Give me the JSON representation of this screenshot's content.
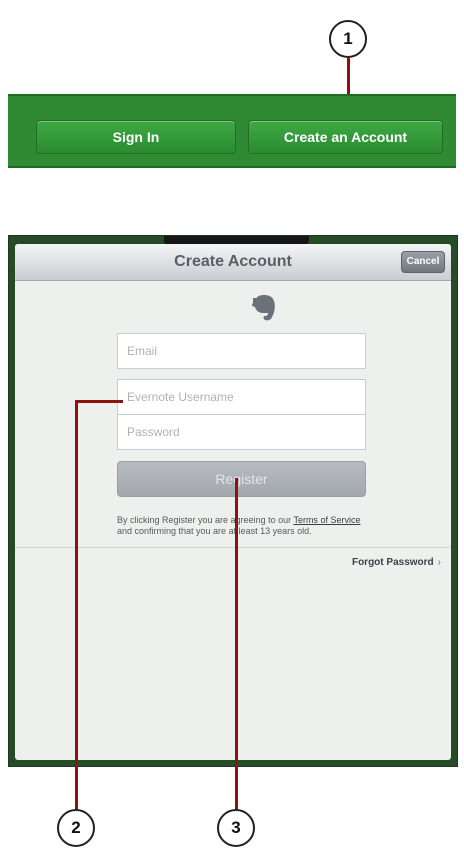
{
  "callouts": {
    "one": "1",
    "two": "2",
    "three": "3"
  },
  "top_bar": {
    "sign_in": "Sign In",
    "create_account": "Create an Account"
  },
  "dialog": {
    "title": "Create Account",
    "cancel": "Cancel",
    "logo_icon": "evernote-elephant-icon",
    "email_placeholder": "Email",
    "username_placeholder": "Evernote Username",
    "password_placeholder": "Password",
    "register": "Register",
    "terms_line1_pre": "By clicking Register you are agreeing to our ",
    "terms_link": "Terms of Service",
    "terms_line2": "and confirming that you are at least 13 years old.",
    "forgot": "Forgot Password",
    "chevron": "›"
  },
  "colors": {
    "green": "#2f8a33",
    "leader": "#8b1313"
  }
}
